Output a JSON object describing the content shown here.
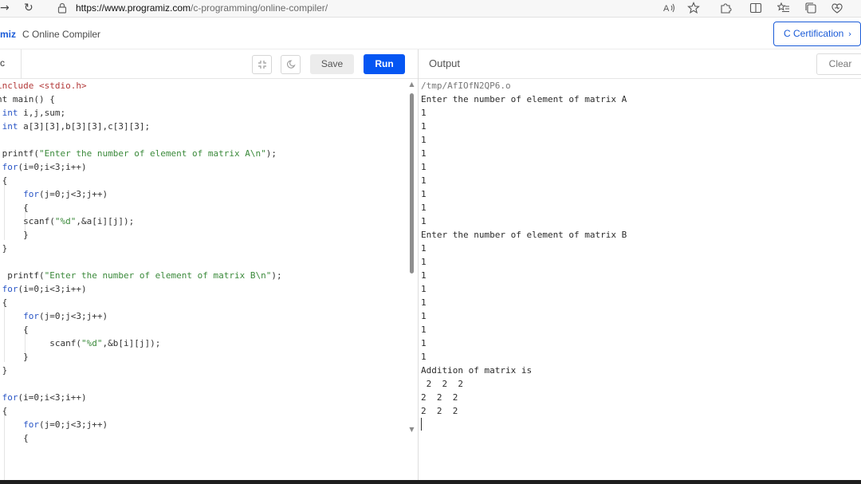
{
  "browser": {
    "back_glyph": "→",
    "reload_glyph": "↻",
    "url_host": "https://www.programiz.com",
    "url_path": "/c-programming/online-compiler/",
    "icons": [
      "read-aloud-icon",
      "favorite-star-icon",
      "extensions-icon",
      "split-screen-icon",
      "favorites-list-icon",
      "collections-icon",
      "browser-essentials-icon"
    ]
  },
  "header": {
    "brand": "miz",
    "title": "C Online Compiler",
    "cert_button": "C Certification",
    "accent": "#1a5bd8"
  },
  "editor": {
    "file_tab": "c",
    "save_label": "Save",
    "run_label": "Run",
    "run_color": "#0556f3",
    "tools": [
      "fullscreen-icon",
      "dark-mode-moon-icon"
    ],
    "lines": [
      [
        {
          "t": "include ",
          "c": "m"
        },
        {
          "t": "<stdio.h>",
          "c": "m"
        }
      ],
      [
        {
          "t": "nt main() {",
          "c": ""
        }
      ],
      [
        {
          "t": " ",
          "c": ""
        },
        {
          "t": "int",
          "c": "k"
        },
        {
          "t": " i,j,sum;",
          "c": ""
        }
      ],
      [
        {
          "t": " ",
          "c": ""
        },
        {
          "t": "int",
          "c": "k"
        },
        {
          "t": " a[3][3],b[3][3],c[3][3];",
          "c": ""
        }
      ],
      [],
      [
        {
          "t": " printf(",
          "c": ""
        },
        {
          "t": "\"Enter the number of element of matrix A\\n\"",
          "c": "s"
        },
        {
          "t": ");",
          "c": ""
        }
      ],
      [
        {
          "t": " ",
          "c": ""
        },
        {
          "t": "for",
          "c": "k"
        },
        {
          "t": "(i=0;i<3;i++)",
          "c": ""
        }
      ],
      [
        {
          "t": " {",
          "c": ""
        }
      ],
      [
        {
          "t": "     ",
          "c": ""
        },
        {
          "t": "for",
          "c": "k"
        },
        {
          "t": "(j=0;j<3;j++)",
          "c": ""
        }
      ],
      [
        {
          "t": "     {",
          "c": ""
        }
      ],
      [
        {
          "t": "     scanf(",
          "c": ""
        },
        {
          "t": "\"%d\"",
          "c": "s"
        },
        {
          "t": ",&a[i][j]);",
          "c": ""
        }
      ],
      [
        {
          "t": "     }",
          "c": ""
        }
      ],
      [
        {
          "t": " }",
          "c": ""
        }
      ],
      [],
      [
        {
          "t": "  printf(",
          "c": ""
        },
        {
          "t": "\"Enter the number of element of matrix B\\n\"",
          "c": "s"
        },
        {
          "t": ");",
          "c": ""
        }
      ],
      [
        {
          "t": " ",
          "c": ""
        },
        {
          "t": "for",
          "c": "k"
        },
        {
          "t": "(i=0;i<3;i++)",
          "c": ""
        }
      ],
      [
        {
          "t": " {",
          "c": ""
        }
      ],
      [
        {
          "t": "     ",
          "c": ""
        },
        {
          "t": "for",
          "c": "k"
        },
        {
          "t": "(j=0;j<3;j++)",
          "c": ""
        }
      ],
      [
        {
          "t": "     {",
          "c": ""
        }
      ],
      [
        {
          "t": "          scanf(",
          "c": ""
        },
        {
          "t": "\"%d\"",
          "c": "s"
        },
        {
          "t": ",&b[i][j]);",
          "c": ""
        }
      ],
      [
        {
          "t": "     }",
          "c": ""
        }
      ],
      [
        {
          "t": " }",
          "c": ""
        }
      ],
      [],
      [
        {
          "t": " ",
          "c": ""
        },
        {
          "t": "for",
          "c": "k"
        },
        {
          "t": "(i=0;i<3;i++)",
          "c": ""
        }
      ],
      [
        {
          "t": " {",
          "c": ""
        }
      ],
      [
        {
          "t": "     ",
          "c": ""
        },
        {
          "t": "for",
          "c": "k"
        },
        {
          "t": "(j=0;j<3;j++)",
          "c": ""
        }
      ],
      [
        {
          "t": "     {",
          "c": ""
        }
      ]
    ]
  },
  "output": {
    "title": "Output",
    "clear_label": "Clear",
    "path": "/tmp/AfIOfN2QP6.o",
    "lines": [
      "Enter the number of element of matrix A",
      "1",
      "1",
      "1",
      "1",
      "1",
      "1",
      "1",
      "1",
      "1",
      "Enter the number of element of matrix B",
      "1",
      "1",
      "1",
      "1",
      "1",
      "1",
      "1",
      "1",
      "1",
      "Addition of matrix is",
      " 2  2  2",
      "2  2  2",
      "2  2  2"
    ]
  }
}
